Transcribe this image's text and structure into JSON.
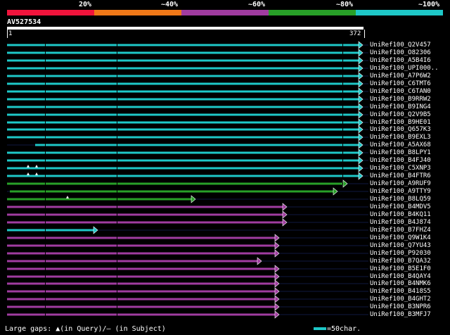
{
  "legend": {
    "segments": [
      {
        "label": "20%",
        "color": "#f0143c"
      },
      {
        "label": "~40%",
        "color": "#f07818"
      },
      {
        "label": "~60%",
        "color": "#a03ca0"
      },
      {
        "label": "~80%",
        "color": "#28a028"
      },
      {
        "label": "~100%",
        "color": "#1ec8c8"
      }
    ]
  },
  "query": {
    "name": "AV527534",
    "start": "1",
    "end": "372"
  },
  "hits": [
    {
      "name": "UniRef100_Q2V457",
      "identity": 100,
      "color": "#1ec8c8"
    },
    {
      "name": "UniRef100_O82306",
      "identity": 100,
      "color": "#1ec8c8"
    },
    {
      "name": "UniRef100_A5B4I6",
      "identity": 100,
      "color": "#1ec8c8"
    },
    {
      "name": "UniRef100_UPI000..",
      "identity": 100,
      "color": "#1ec8c8"
    },
    {
      "name": "UniRef100_A7P6W2",
      "identity": 100,
      "color": "#1ec8c8"
    },
    {
      "name": "UniRef100_C6TMT6",
      "identity": 100,
      "color": "#1ec8c8"
    },
    {
      "name": "UniRef100_C6TAN0",
      "identity": 100,
      "color": "#1ec8c8"
    },
    {
      "name": "UniRef100_B9RRW2",
      "identity": 100,
      "color": "#1ec8c8"
    },
    {
      "name": "UniRef100_B9ING4",
      "identity": 100,
      "color": "#1ec8c8"
    },
    {
      "name": "UniRef100_Q2V9B5",
      "identity": 100,
      "color": "#1ec8c8"
    },
    {
      "name": "UniRef100_B9HE01",
      "identity": 100,
      "color": "#1ec8c8"
    },
    {
      "name": "UniRef100_Q657K3",
      "identity": 100,
      "color": "#1ec8c8"
    },
    {
      "name": "UniRef100_B9EXL3",
      "identity": 100,
      "color": "#1ec8c8"
    },
    {
      "name": "UniRef100_A5AX68",
      "identity": 100,
      "color": "#1ec8c8"
    },
    {
      "name": "UniRef100_B8LPY1",
      "identity": 100,
      "color": "#1ec8c8"
    },
    {
      "name": "UniRef100_B4FJ40",
      "identity": 100,
      "color": "#1ec8c8"
    },
    {
      "name": "UniRef100_C5XNP3",
      "identity": 100,
      "color": "#1ec8c8"
    },
    {
      "name": "UniRef100_B4FTR6",
      "identity": 100,
      "color": "#1ec8c8"
    },
    {
      "name": "UniRef100_A9RUF9",
      "identity": 80,
      "color": "#28a028"
    },
    {
      "name": "UniRef100_A9TTY9",
      "identity": 80,
      "color": "#28a028"
    },
    {
      "name": "UniRef100_B8LQ59",
      "identity": 80,
      "color": "#28a028"
    },
    {
      "name": "UniRef100_B4MDV5",
      "identity": 60,
      "color": "#a03ca0"
    },
    {
      "name": "UniRef100_B4KQ11",
      "identity": 60,
      "color": "#a03ca0"
    },
    {
      "name": "UniRef100_B4J874",
      "identity": 60,
      "color": "#a03ca0"
    },
    {
      "name": "UniRef100_B7FHZ4",
      "identity": 100,
      "color": "#1ec8c8"
    },
    {
      "name": "UniRef100_Q9W1K4",
      "identity": 60,
      "color": "#a03ca0"
    },
    {
      "name": "UniRef100_Q7YU43",
      "identity": 60,
      "color": "#a03ca0"
    },
    {
      "name": "UniRef100_P92030",
      "identity": 60,
      "color": "#a03ca0"
    },
    {
      "name": "UniRef100_B7QA32",
      "identity": 60,
      "color": "#a03ca0"
    },
    {
      "name": "UniRef100_B5E1F0",
      "identity": 60,
      "color": "#a03ca0"
    },
    {
      "name": "UniRef100_B4QAY4",
      "identity": 60,
      "color": "#a03ca0"
    },
    {
      "name": "UniRef100_B4NMK6",
      "identity": 60,
      "color": "#a03ca0"
    },
    {
      "name": "UniRef100_B418S5",
      "identity": 60,
      "color": "#a03ca0"
    },
    {
      "name": "UniRef100_B4GHT2",
      "identity": 60,
      "color": "#a03ca0"
    },
    {
      "name": "UniRef100_B3NPR6",
      "identity": 60,
      "color": "#a03ca0"
    },
    {
      "name": "UniRef100_B3MFJ7",
      "identity": 60,
      "color": "#a03ca0"
    }
  ],
  "footer": {
    "gaps_prefix": "Large gaps: ",
    "gaps_query": "▲(in Query)/",
    "gaps_subject": "— (in Subject)",
    "scale_text": "=50char."
  }
}
